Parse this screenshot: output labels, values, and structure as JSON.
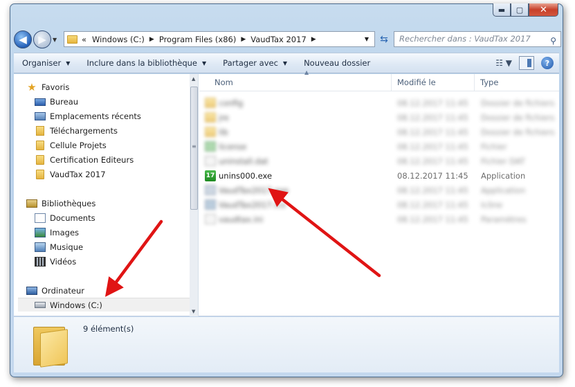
{
  "window": {
    "caption": {
      "minimize": "▬",
      "maximize": "▢",
      "close": "✕"
    }
  },
  "address_bar": {
    "overflow": "«",
    "crumbs": [
      "Windows (C:)",
      "Program Files (x86)",
      "VaudTax 2017"
    ],
    "search_placeholder": "Rechercher dans : VaudTax 2017"
  },
  "toolbar": {
    "organize": "Organiser",
    "include_library": "Inclure dans la bibliothèque",
    "share_with": "Partager avec",
    "new_folder": "Nouveau dossier"
  },
  "nav": {
    "favorites": {
      "label": "Favoris",
      "items": [
        "Bureau",
        "Emplacements récents",
        "Téléchargements",
        "Cellule Projets",
        "Certification Editeurs",
        "VaudTax 2017"
      ]
    },
    "libraries": {
      "label": "Bibliothèques",
      "items": [
        "Documents",
        "Images",
        "Musique",
        "Vidéos"
      ]
    },
    "computer": {
      "label": "Ordinateur",
      "items": [
        "Windows (C:)"
      ]
    }
  },
  "file_list": {
    "columns": {
      "name": "Nom",
      "modified": "Modifié le",
      "type": "Type"
    },
    "visible_file": {
      "name": "unins000.exe",
      "modified": "08.12.2017 11:45",
      "type": "Application",
      "icon_text": "17"
    },
    "blurred_rows": [
      {
        "name": "config",
        "modified": "08.12.2017 11:45",
        "type": "Dossier de fichiers"
      },
      {
        "name": "jre",
        "modified": "08.12.2017 11:45",
        "type": "Dossier de fichiers"
      },
      {
        "name": "lib",
        "modified": "08.12.2017 11:45",
        "type": "Dossier de fichiers"
      },
      {
        "name": "license",
        "modified": "08.12.2017 11:45",
        "type": "Fichier"
      },
      {
        "name": "uninstall.dat",
        "modified": "08.12.2017 11:45",
        "type": "Fichier DAT"
      },
      {
        "name": "VaudTax2017.exe",
        "modified": "08.12.2017 11:45",
        "type": "Application"
      },
      {
        "name": "VaudTax2017.ico",
        "modified": "08.12.2017 11:45",
        "type": "Icône"
      },
      {
        "name": "vaudtax.ini",
        "modified": "08.12.2017 11:45",
        "type": "Paramètres"
      }
    ]
  },
  "details": {
    "count": "9 élément(s)"
  },
  "colors": {
    "arrow": "#e01414",
    "window_frame": "#b9d1ea",
    "app_icon": "#2a9a2e"
  }
}
